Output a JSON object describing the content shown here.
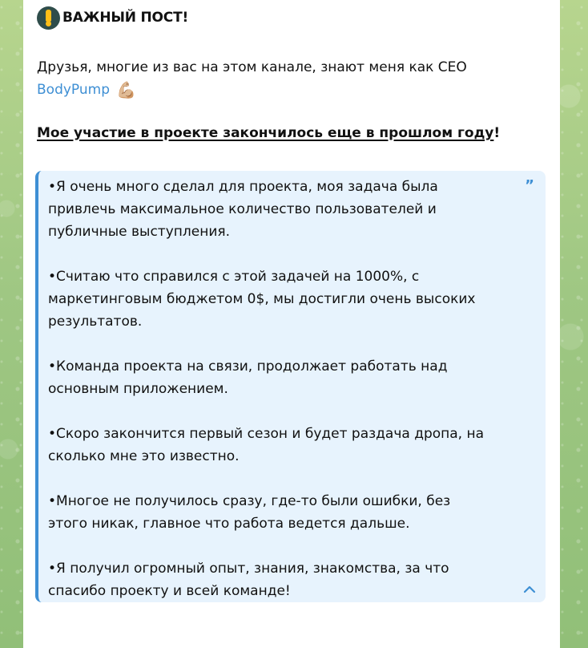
{
  "post": {
    "title": "ВАЖНЫЙ ПОСТ!",
    "intro_line_1": "Друзья, многие из вас на этом канале, знают меня как CEO",
    "brand": "BodyPump",
    "notice_text": "Мое участие в проекте закончилось еще в прошлом году",
    "notice_suffix": "!",
    "quote": {
      "paragraphs": [
        {
          "lines": [
            "•Я очень много сделал для проекта, моя задача была",
            "привлечь максимальное количество пользователей и",
            "публичные выступления."
          ]
        },
        {
          "lines": [
            "•Считаю что справился с этой задачей на 1000%, с",
            "маркетинговым бюджетом 0$, мы достигли очень высоких",
            "результатов."
          ]
        },
        {
          "lines": [
            "•Команда проекта на связи, продолжает работать над",
            "основным приложением."
          ]
        },
        {
          "lines": [
            "•Скоро закончится первый сезон и будет раздача дропа, на",
            "сколько мне это известно."
          ]
        },
        {
          "lines": [
            "•Многое не получилось сразу, где-то были ошибки, без",
            "этого никак, главное что работа ведется дальше."
          ]
        },
        {
          "lines": [
            "•Я получил огромный опыт, знания, знакомства, за что",
            "спасибо проекту и всей команде!"
          ]
        }
      ]
    }
  },
  "icons": {
    "alert": "alert-icon",
    "muscle": "muscle-emoji",
    "quote_mark": "quote-mark-icon",
    "collapse": "chevron-up-icon"
  },
  "emoji": {
    "muscle": "💪🏼"
  },
  "colors": {
    "wallpaper": "#a6c78e",
    "card": "#ffffff",
    "text": "#111111",
    "link": "#3e8fd4",
    "quote_bg": "#e7f3fd",
    "quote_border": "#3e8fd4",
    "alert_bg": "#2f4d4b",
    "alert_fg": "#ffbe18"
  }
}
